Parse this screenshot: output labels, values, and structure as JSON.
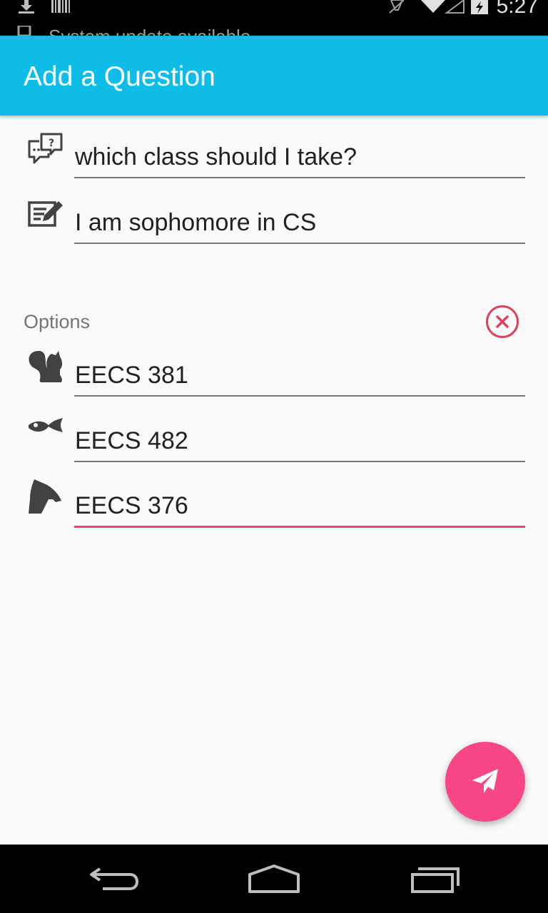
{
  "status_bar": {
    "notification_text": "System update available",
    "time": "5:27",
    "icons": [
      "download-icon",
      "barcode-icon",
      "no-signal-icon",
      "wifi-icon",
      "battery-charging-icon"
    ]
  },
  "app_bar": {
    "title": "Add a Question"
  },
  "question": {
    "icon": "question-bubble-icon",
    "value": "which class should I take?"
  },
  "description": {
    "icon": "edit-note-icon",
    "value": "I am sophomore in CS"
  },
  "options": {
    "label": "Options",
    "clear_icon": "close-circle-icon",
    "items": [
      {
        "icon": "squirrel-icon",
        "value": "EECS 381"
      },
      {
        "icon": "fish-icon",
        "value": "EECS 482"
      },
      {
        "icon": "knight-icon",
        "value": "EECS 376",
        "focused": true
      }
    ]
  },
  "fab": {
    "icon": "send-icon"
  },
  "nav_bar": {
    "icons": [
      "back-icon",
      "home-icon",
      "recents-icon"
    ]
  },
  "colors": {
    "app_bar": "#0dbde8",
    "accent": "#f84787",
    "focus_underline": "#ec407a",
    "clear_icon": "#e0405e"
  }
}
